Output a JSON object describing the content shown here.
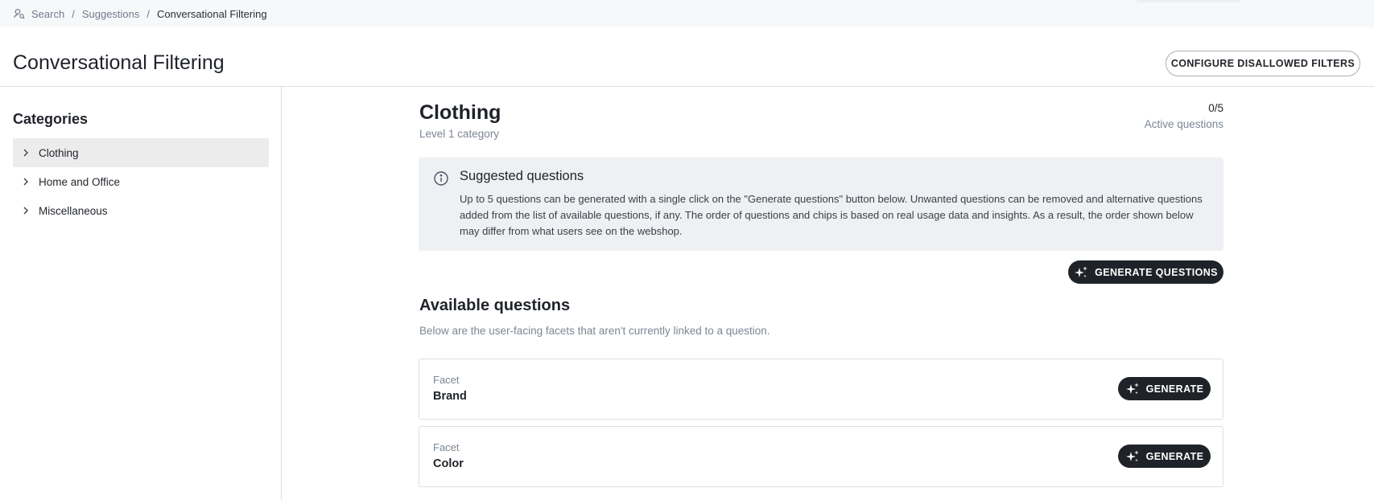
{
  "breadcrumb": {
    "items": [
      "Search",
      "Suggestions"
    ],
    "current": "Conversational Filtering",
    "separator": "/"
  },
  "header": {
    "title": "Conversational Filtering",
    "configure_button": "CONFIGURE DISALLOWED FILTERS"
  },
  "sidebar": {
    "title": "Categories",
    "items": [
      {
        "label": "Clothing",
        "active": true
      },
      {
        "label": "Home and Office",
        "active": false
      },
      {
        "label": "Miscellaneous",
        "active": false
      }
    ]
  },
  "category": {
    "title": "Clothing",
    "subtitle": "Level 1 category",
    "active_count": "0/5",
    "active_label": "Active questions"
  },
  "suggested": {
    "title": "Suggested questions",
    "text": "Up to 5 questions can be generated with a single click on the \"Generate questions\" button below. Unwanted questions can be removed and alternative questions added from the list of available questions, if any. The order of questions and chips is based on real usage data and insights. As a result, the order shown below may differ from what users see on the webshop.",
    "generate_button": "GENERATE QUESTIONS"
  },
  "available": {
    "title": "Available questions",
    "subtitle": "Below are the user-facing facets that aren't currently linked to a question.",
    "facets": [
      {
        "label": "Facet",
        "name": "Brand",
        "button": "GENERATE"
      },
      {
        "label": "Facet",
        "name": "Color",
        "button": "GENERATE"
      }
    ]
  },
  "colors": {
    "primary_button": "#1f2329",
    "info_background": "#eff0f3",
    "active_item_background": "#ececed",
    "muted_text": "#7c8695"
  },
  "icons": {
    "breadcrumb": "search-suggestions-icon",
    "chevron": "chevron-right-icon",
    "info": "info-circle-icon",
    "generate": "sparkle-icon"
  }
}
